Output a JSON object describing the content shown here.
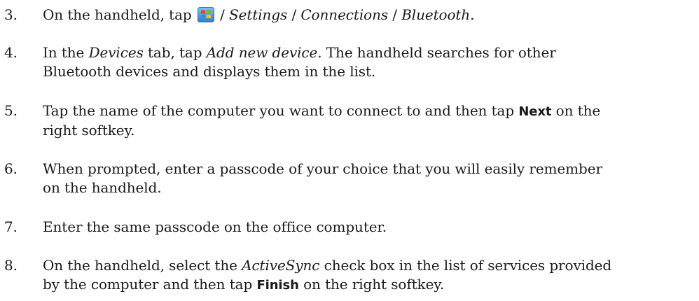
{
  "steps": [
    {
      "number": "3.",
      "parts": {
        "a": "On the handheld, tap ",
        "b": " / ",
        "c": "Settings",
        "d": " / ",
        "e": "Connections",
        "f": " / ",
        "g": "Bluetooth",
        "h": "."
      },
      "icon": "windows-start-icon"
    },
    {
      "number": "4.",
      "parts": {
        "a": "In the ",
        "b": "Devices",
        "c": " tab, tap ",
        "d": "Add new device",
        "e": ". The handheld searches for other",
        "f": "Bluetooth devices and displays them in the list."
      }
    },
    {
      "number": "5.",
      "parts": {
        "a": "Tap the name of the computer you want to connect to and then tap ",
        "b": "Next",
        "c": " on the",
        "d": "right softkey."
      }
    },
    {
      "number": "6.",
      "parts": {
        "a": "When prompted, enter a passcode of your choice that you will easily remember",
        "b": "on the handheld."
      }
    },
    {
      "number": "7.",
      "parts": {
        "a": "Enter the same passcode on the office computer."
      }
    },
    {
      "number": "8.",
      "parts": {
        "a": "On the handheld, select the ",
        "b": "ActiveSync",
        "c": " check box in the list of services provided",
        "d": "by the computer and then tap ",
        "e": "Finish",
        "f": " on the right softkey."
      }
    }
  ],
  "colors": {
    "text": "#1a1a1a",
    "icon_red": "#e8412c",
    "icon_green": "#6cbf2b",
    "icon_blue": "#2f8fd8",
    "icon_yellow": "#f7c31a"
  }
}
